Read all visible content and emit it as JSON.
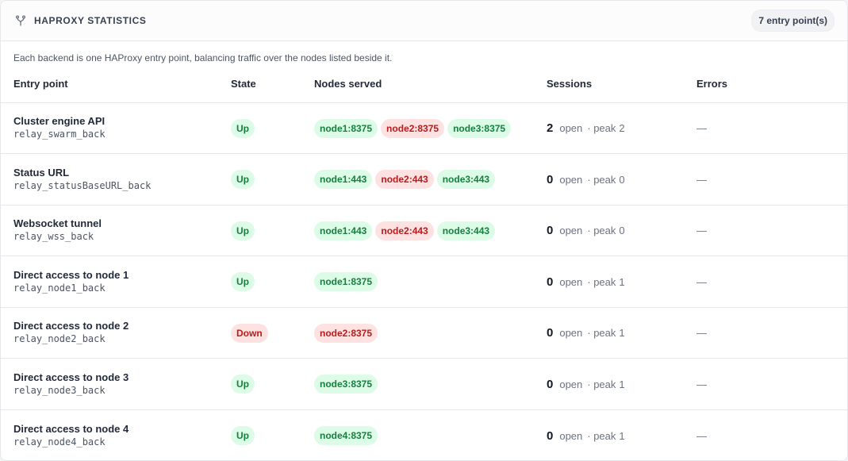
{
  "header": {
    "title": "HAPROXY STATISTICS",
    "badge": "7 entry point(s)",
    "icon": "fork-icon"
  },
  "description": "Each backend is one HAProxy entry point, balancing traffic over the nodes listed beside it.",
  "columns": {
    "entry": "Entry point",
    "state": "State",
    "nodes": "Nodes served",
    "sessions": "Sessions",
    "errors": "Errors"
  },
  "labels": {
    "open": "open",
    "peak": "· peak"
  },
  "colors": {
    "up_bg": "#dcfce7",
    "up_fg": "#15803d",
    "down_bg": "#fee2e2",
    "down_fg": "#b91c1c"
  },
  "rows": [
    {
      "name": "Cluster engine API",
      "id": "relay_swarm_back",
      "state": "Up",
      "nodes": [
        {
          "label": "node1:8375",
          "status": "up"
        },
        {
          "label": "node2:8375",
          "status": "down"
        },
        {
          "label": "node3:8375",
          "status": "up"
        }
      ],
      "open": "2",
      "peak": "2",
      "errors": "—"
    },
    {
      "name": "Status URL",
      "id": "relay_statusBaseURL_back",
      "state": "Up",
      "nodes": [
        {
          "label": "node1:443",
          "status": "up"
        },
        {
          "label": "node2:443",
          "status": "down"
        },
        {
          "label": "node3:443",
          "status": "up"
        }
      ],
      "open": "0",
      "peak": "0",
      "errors": "—"
    },
    {
      "name": "Websocket tunnel",
      "id": "relay_wss_back",
      "state": "Up",
      "nodes": [
        {
          "label": "node1:443",
          "status": "up"
        },
        {
          "label": "node2:443",
          "status": "down"
        },
        {
          "label": "node3:443",
          "status": "up"
        }
      ],
      "open": "0",
      "peak": "0",
      "errors": "—"
    },
    {
      "name": "Direct access to node 1",
      "id": "relay_node1_back",
      "state": "Up",
      "nodes": [
        {
          "label": "node1:8375",
          "status": "up"
        }
      ],
      "open": "0",
      "peak": "1",
      "errors": "—"
    },
    {
      "name": "Direct access to node 2",
      "id": "relay_node2_back",
      "state": "Down",
      "nodes": [
        {
          "label": "node2:8375",
          "status": "down"
        }
      ],
      "open": "0",
      "peak": "1",
      "errors": "—"
    },
    {
      "name": "Direct access to node 3",
      "id": "relay_node3_back",
      "state": "Up",
      "nodes": [
        {
          "label": "node3:8375",
          "status": "up"
        }
      ],
      "open": "0",
      "peak": "1",
      "errors": "—"
    },
    {
      "name": "Direct access to node 4",
      "id": "relay_node4_back",
      "state": "Up",
      "nodes": [
        {
          "label": "node4:8375",
          "status": "up"
        }
      ],
      "open": "0",
      "peak": "1",
      "errors": "—"
    }
  ]
}
